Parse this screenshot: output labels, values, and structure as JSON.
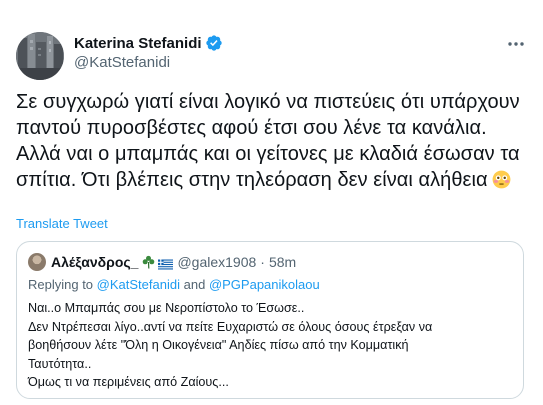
{
  "tweet": {
    "author": {
      "display_name": "Katerina Stefanidi",
      "handle": "@KatStefanidi",
      "verified": true
    },
    "text": "Σε συγχωρώ γιατί είναι λογικό να πιστεύεις ότι υπάρχουν παντού πυροσβέστες αφού έτσι σου λένε τα κανάλια. Αλλά ναι ο μπαμπάς και οι γείτονες με κλαδιά έσωσαν τα σπίτια. Ότι βλέπεις στην τηλεόραση δεν είναι αλήθεια",
    "emoji": "flushed-face",
    "translate_label": "Translate Tweet",
    "more_icon": "more-horizontal-icon"
  },
  "quote": {
    "author": {
      "display_name": "Αλέξανδρος_",
      "handle": "@galex1908",
      "separator": "·",
      "time": "58m",
      "badges": [
        "shamrock-icon",
        "greek-flag-icon"
      ]
    },
    "replying": {
      "prefix": "Replying to",
      "mention1": "@KatStefanidi",
      "conjunction": "and",
      "mention2": "@PGPapanikolaou"
    },
    "lines": [
      "Ναι..ο Μπαμπάς σου με Νεροπίστολο το Έσωσε..",
      "Δεν Ντρέπεσαι λίγο..αντί να πείτε Ευχαριστώ σε όλους όσους έτρεξαν να",
      "βοηθήσουν λέτε \"Όλη η Οικογένεια\" Αηδίες πίσω από την Κομματική",
      "Ταυτότητα..",
      "Όμως τι να περιμένεις από Ζαίους..."
    ]
  },
  "colors": {
    "text": "#0f1419",
    "secondary": "#536471",
    "accent": "#1d9bf0",
    "border": "#cfd9de"
  }
}
